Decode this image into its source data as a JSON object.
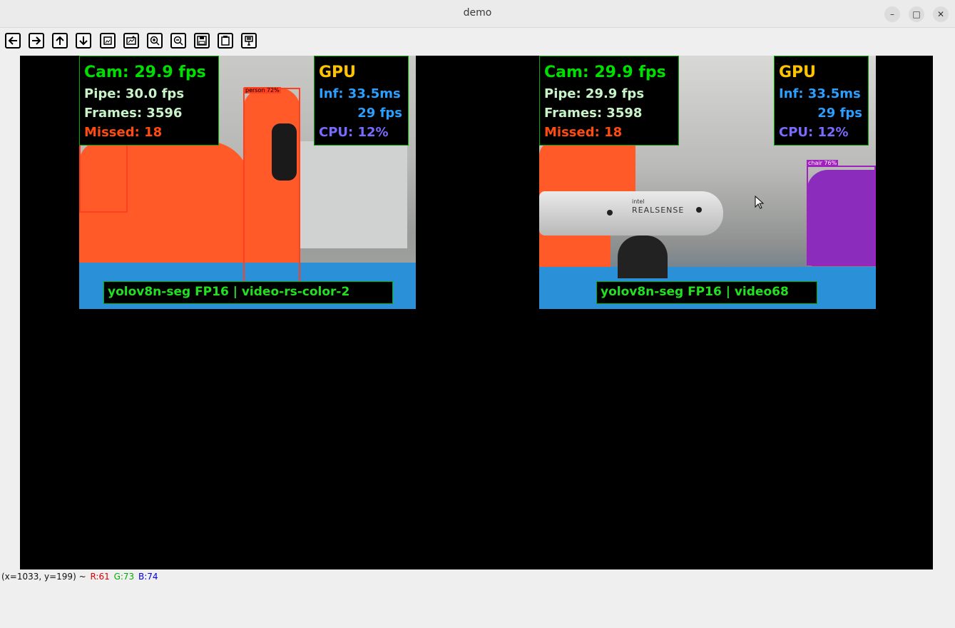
{
  "window": {
    "title": "demo",
    "minimize": "–",
    "maximize": "□",
    "close": "✕"
  },
  "toolbar": {
    "buttons": [
      "arrow-left-icon",
      "arrow-right-icon",
      "arrow-up-icon",
      "arrow-down-icon",
      "zoom-fit-icon",
      "zoom-image-icon",
      "zoom-in-icon",
      "zoom-out-icon",
      "save-icon",
      "clipboard-icon",
      "properties-icon"
    ]
  },
  "feeds": [
    {
      "overlay_left": {
        "cam": "Cam: 29.9 fps",
        "pipe": "Pipe: 30.0 fps",
        "frames": "Frames: 3596",
        "missed": "Missed: 18"
      },
      "overlay_right": {
        "header": "GPU",
        "inf": "Inf: 33.5ms",
        "fps": "29 fps",
        "cpu": "CPU: 12%"
      },
      "bottom": "yolov8n-seg  FP16  |  video-rs-color-2",
      "detection_label": "person 72%"
    },
    {
      "overlay_left": {
        "cam": "Cam: 29.9 fps",
        "pipe": "Pipe: 29.9 fps",
        "frames": "Frames: 3598",
        "missed": "Missed: 18"
      },
      "overlay_right": {
        "header": "GPU",
        "inf": "Inf: 33.5ms",
        "fps": "29 fps",
        "cpu": "CPU: 12%"
      },
      "bottom": "yolov8n-seg  FP16  |  video68",
      "detection_label": "chair 76%",
      "camera_brand_small": "intel",
      "camera_brand": "REALSENSE"
    }
  ],
  "status": {
    "coords": "(x=1033, y=199) ~",
    "r": "R:61",
    "g": "G:73",
    "b": "B:74"
  },
  "colors": {
    "green": "#22e022",
    "cam": "#00e000",
    "missed": "#ff4a10",
    "gpu": "#ffc400",
    "inf": "#2a9fff",
    "cpu": "#7a6bff",
    "mask": "#ff5a28"
  }
}
